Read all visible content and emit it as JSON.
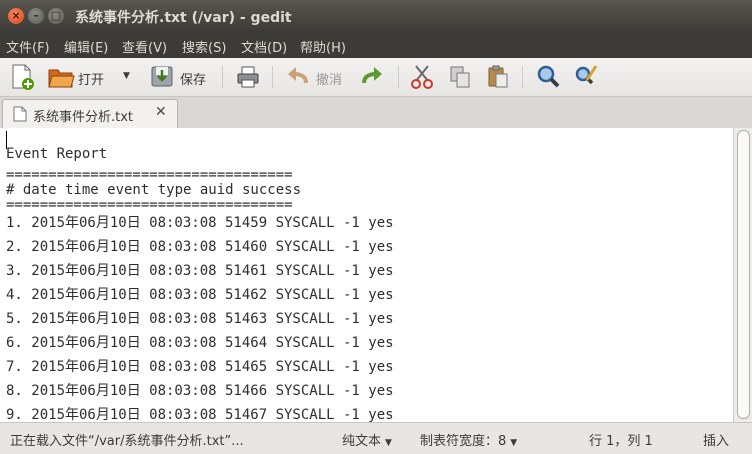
{
  "window": {
    "title": "系统事件分析.txt (/var) - gedit"
  },
  "menubar": {
    "items": [
      "文件(F)",
      "编辑(E)",
      "查看(V)",
      "搜索(S)",
      "文档(D)",
      "帮助(H)"
    ]
  },
  "toolbar": {
    "open_label": "打开",
    "save_label": "保存",
    "undo_label": "撤消"
  },
  "tab": {
    "label": "系统事件分析.txt"
  },
  "document": {
    "lines": [
      "Event Report",
      "==================================",
      "# date time event type auid success",
      "==================================",
      "1. 2015年06月10日 08:03:08 51459 SYSCALL -1 yes",
      "2. 2015年06月10日 08:03:08 51460 SYSCALL -1 yes",
      "3. 2015年06月10日 08:03:08 51461 SYSCALL -1 yes",
      "4. 2015年06月10日 08:03:08 51462 SYSCALL -1 yes",
      "5. 2015年06月10日 08:03:08 51463 SYSCALL -1 yes",
      "6. 2015年06月10日 08:03:08 51464 SYSCALL -1 yes",
      "7. 2015年06月10日 08:03:08 51465 SYSCALL -1 yes",
      "8. 2015年06月10日 08:03:08 51466 SYSCALL -1 yes",
      "9. 2015年06月10日 08:03:08 51467 SYSCALL -1 yes"
    ]
  },
  "statusbar": {
    "loading_text": "正在载入文件“/var/系统事件分析.txt”...",
    "syntax_mode": "纯文本",
    "tab_width": "制表符宽度：8",
    "position": "行 1，列 1",
    "insert_mode": "插入"
  },
  "colors": {
    "titlebar": "#3c3b37",
    "close_button": "#df4a16",
    "toolbar": "#f2f1f0"
  }
}
